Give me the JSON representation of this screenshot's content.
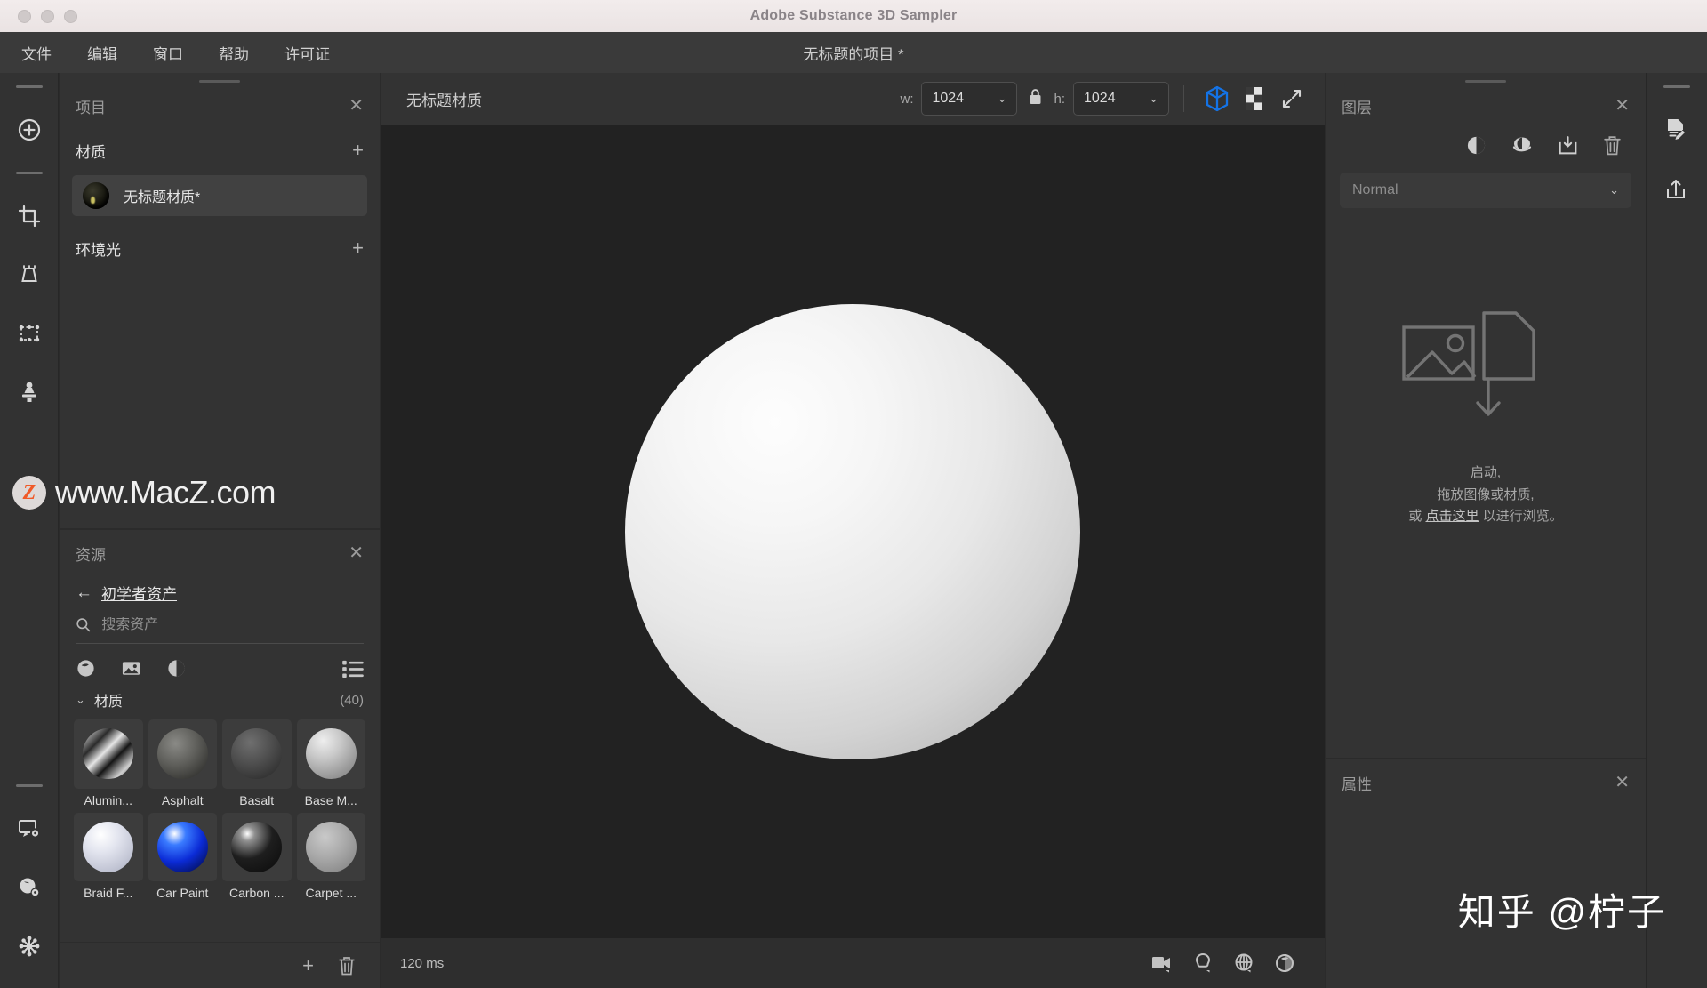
{
  "window": {
    "app_title": "Adobe Substance 3D Sampler",
    "traffic_lights": [
      "close",
      "minimize",
      "zoom"
    ]
  },
  "menubar": {
    "items": [
      "文件",
      "编辑",
      "窗口",
      "帮助",
      "许可证"
    ],
    "project_title": "无标题的项目 *"
  },
  "left_rail": {
    "tools": [
      {
        "name": "add-layer-icon",
        "label": "添加"
      },
      {
        "name": "crop-icon",
        "label": "裁剪"
      },
      {
        "name": "perspective-icon",
        "label": "透视"
      },
      {
        "name": "transform-icon",
        "label": "变换"
      },
      {
        "name": "clone-stamp-icon",
        "label": "仿制图章"
      }
    ],
    "bottom_tools": [
      {
        "name": "display-settings-icon",
        "label": "显示设置"
      },
      {
        "name": "material-settings-icon",
        "label": "材质设置"
      },
      {
        "name": "graph-nodes-icon",
        "label": "节点图"
      }
    ]
  },
  "project_panel": {
    "title": "项目",
    "close_label": "✕",
    "sections": [
      {
        "title": "材质",
        "add_label": "+"
      },
      {
        "title": "环境光",
        "add_label": "+"
      }
    ],
    "material_item": "无标题材质*"
  },
  "assets_panel": {
    "title": "资源",
    "close_label": "✕",
    "breadcrumb_back": "←",
    "breadcrumb": "初学者资产",
    "search_placeholder": "搜索资产",
    "search_value": "",
    "filter_icons": [
      "material-filter-icon",
      "image-filter-icon",
      "filter-filter-icon"
    ],
    "view_icon": "list-view-icon",
    "group": {
      "name": "材质",
      "count": "(40)",
      "caret": "⌄"
    },
    "thumbnails": [
      {
        "label": "Alumin...",
        "color": "linear-gradient(135deg,#f7f7f7 0%,#2b2b2b 28%,#e6e6e6 45%,#151515 62%,#cfcfcf 82%,#3a3a3a 100%)"
      },
      {
        "label": "Asphalt",
        "color": "radial-gradient(circle at 36% 30%, #8a8a86 0%, #5e5e5a 45%, #3a3a37 78%, #262624 100%)"
      },
      {
        "label": "Basalt",
        "color": "radial-gradient(circle at 38% 28%, #6f6f6f 0%, #4e4e4e 45%, #333333 80%, #242424 100%)"
      },
      {
        "label": "Base M...",
        "color": "radial-gradient(circle at 34% 24%, #eeeeee 0%, #c8c8c8 35%, #9b9b9b 70%, #7a7a7a 100%)"
      },
      {
        "label": "Braid F...",
        "color": "radial-gradient(circle at 36% 26%, #ffffff 0%, #e3e5ef 35%, #c4c7d6 70%, #a7abbd 100%)"
      },
      {
        "label": "Car Paint",
        "color": "radial-gradient(circle at 34% 24%, #ffffff 0%, #3a7bff 22%, #0b2bd6 55%, #041268 85%, #020838 100%)"
      },
      {
        "label": "Carbon ...",
        "color": "radial-gradient(circle at 32% 24%, #ffffff 0%, #909090 14%, #1e1e1e 48%, #0a0a0a 100%)"
      },
      {
        "label": "Carpet ...",
        "color": "radial-gradient(circle at 38% 30%, #c9c9c9 0%, #ababab 42%, #8e8e8e 78%, #7b7b7b 100%)"
      }
    ],
    "footer_add": "+",
    "footer_delete": "delete-icon"
  },
  "viewport": {
    "material_title": "无标题材质",
    "width_label": "w:",
    "width_value": "1024",
    "height_label": "h:",
    "height_value": "1024",
    "lock_icon": "lock-icon",
    "toolbar_icons": [
      "3d-view-icon",
      "2d-view-icon",
      "fullscreen-icon"
    ],
    "status_text": "120 ms",
    "status_icons": [
      "camera-icon",
      "lighting-icon",
      "environment-icon",
      "material-preview-icon"
    ],
    "accent_color": "#1473e6"
  },
  "layers_panel": {
    "title": "图层",
    "close_label": "✕",
    "tool_icons": [
      "adjustment-icon",
      "mask-icon",
      "import-icon",
      "delete-icon"
    ],
    "blend_mode": "Normal",
    "dropzone": {
      "line1": "启动,",
      "line2": "拖放图像或材质,",
      "line3_prefix": "或 ",
      "line3_link": "点击这里",
      "line3_suffix": " 以进行浏览。"
    }
  },
  "properties_panel": {
    "title": "属性",
    "close_label": "✕"
  },
  "right_rail": {
    "tools": [
      {
        "name": "document-edit-icon",
        "label": "文档"
      },
      {
        "name": "export-icon",
        "label": "导出"
      }
    ]
  },
  "watermarks": {
    "left": "www.MacZ.com",
    "left_logo": "Z",
    "right": "知乎 @柠子"
  }
}
